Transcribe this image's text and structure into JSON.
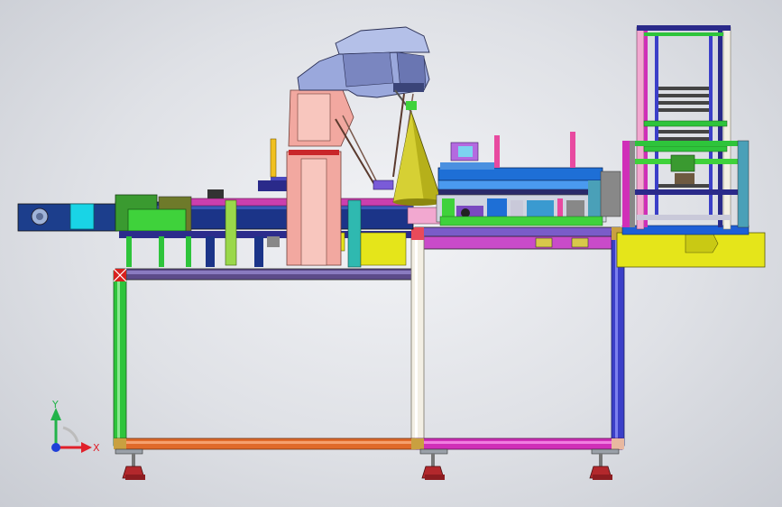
{
  "viewport": {
    "background_center": "#f2f3f6",
    "background_edge": "#c9ccd3"
  },
  "model": {
    "description_components": [
      "left-infeed-conveyor",
      "delta-robot",
      "robot-cone",
      "center-conveyor",
      "right-stacker-tower",
      "base-frame",
      "leveling-feet"
    ]
  },
  "triad": {
    "x_label": "X",
    "y_label": "Y",
    "z_color": "#1f3fd8",
    "x_color": "#e0202a",
    "y_color": "#22b34a"
  },
  "colors": {
    "frame_left": "#2ec43b",
    "frame_mid": "#f3efe4",
    "frame_right": "#3b3fc8",
    "beam_bottom_left": "#e06a2a",
    "beam_bottom_right": "#d02fb8",
    "robot_body": "#9aa8dc",
    "robot_arm": "#f2a8a0",
    "cone": "#b6b01a",
    "conveyor_blue": "#1e6fd6",
    "tower": "#2f9a3a",
    "base_yellow": "#e5e51a",
    "feet": "#b3282c"
  }
}
